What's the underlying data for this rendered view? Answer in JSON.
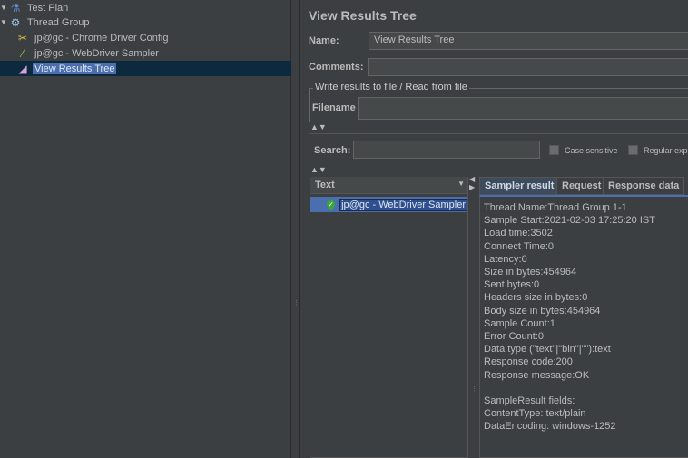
{
  "tree": [
    {
      "label": "Test Plan",
      "icon": "flask-icon"
    },
    {
      "label": "Thread Group",
      "icon": "gear-icon"
    },
    {
      "label": "jp@gc - Chrome Driver Config",
      "icon": "wrench-icon"
    },
    {
      "label": "jp@gc - WebDriver Sampler",
      "icon": "pipette-icon"
    },
    {
      "label": "View Results Tree",
      "icon": "chart-icon",
      "selected": true
    }
  ],
  "panel": {
    "title": "View Results Tree",
    "name_label": "Name:",
    "name_value": "View Results Tree",
    "comments_label": "Comments:",
    "comments_value": "",
    "file_group": "Write results to file / Read from file",
    "filename_label": "Filename",
    "filename_value": "",
    "search_label": "Search:",
    "search_value": "",
    "case_sensitive": "Case sensitive",
    "regex": "Regular exp"
  },
  "results": {
    "column": "Text",
    "rows": [
      {
        "label": "jp@gc - WebDriver Sampler",
        "status": "success"
      }
    ]
  },
  "tabs": [
    "Sampler result",
    "Request",
    "Response data"
  ],
  "sampler_lines": [
    "Thread Name:Thread Group 1-1",
    "Sample Start:2021-02-03 17:25:20 IST",
    "Load time:3502",
    "Connect Time:0",
    "Latency:0",
    "Size in bytes:454964",
    "Sent bytes:0",
    "Headers size in bytes:0",
    "Body size in bytes:454964",
    "Sample Count:1",
    "Error Count:0",
    "Data type (\"text\"|\"bin\"|\"\"):text",
    "Response code:200",
    "Response message:OK",
    "",
    "SampleResult fields:",
    "ContentType: text/plain",
    "DataEncoding: windows-1252"
  ]
}
